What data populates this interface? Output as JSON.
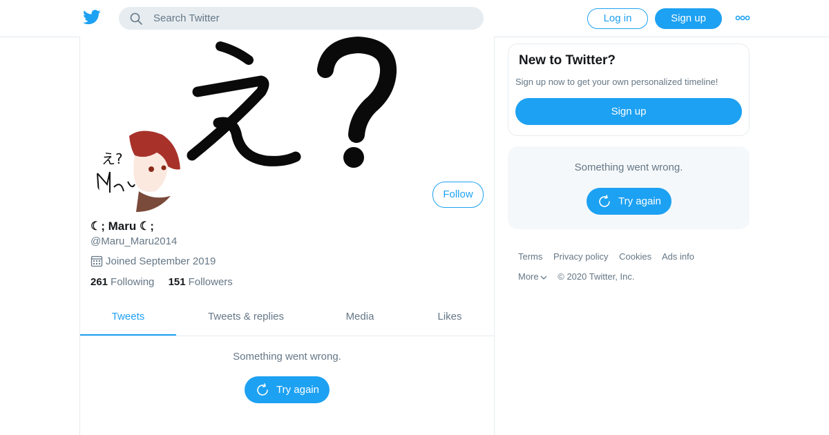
{
  "search": {
    "placeholder": "Search Twitter"
  },
  "nav": {
    "login_label": "Log in",
    "signup_label": "Sign up"
  },
  "profile": {
    "display_name": "☾; Maru ☾;",
    "handle": "@Maru_Maru2014",
    "joined": "Joined September 2019",
    "following_count": "261",
    "following_label": "Following",
    "followers_count": "151",
    "followers_label": "Followers",
    "follow_label": "Follow"
  },
  "tabs": [
    {
      "label": "Tweets",
      "active": true
    },
    {
      "label": "Tweets & replies"
    },
    {
      "label": "Media"
    },
    {
      "label": "Likes"
    }
  ],
  "timeline": {
    "error_text": "Something went wrong.",
    "try_again": "Try again"
  },
  "sidebar": {
    "new_title": "New to Twitter?",
    "new_subtitle": "Sign up now to get your own personalized timeline!",
    "signup_label": "Sign up",
    "error_text": "Something went wrong.",
    "try_again": "Try again"
  },
  "footer": {
    "links": [
      "Terms",
      "Privacy policy",
      "Cookies",
      "Ads info"
    ],
    "more_label": "More",
    "copyright": "© 2020 Twitter, Inc."
  },
  "banner_text": "え？",
  "avatar_text": "え?",
  "colors": {
    "accent": "#1da1f2",
    "secondary_text": "#657786",
    "border": "#e6ecf0"
  }
}
